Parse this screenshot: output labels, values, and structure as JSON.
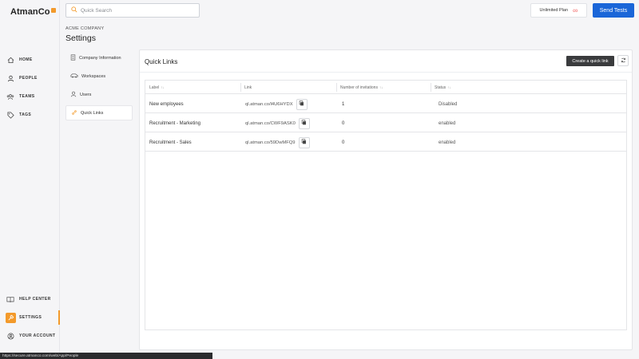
{
  "app": {
    "logo_text": "AtmanCo"
  },
  "search": {
    "placeholder": "Quick Search"
  },
  "topbar": {
    "plan_label": "Unlimited Plan",
    "plan_symbol": "∞",
    "send_tests_label": "Send Tests"
  },
  "nav": {
    "items": [
      {
        "key": "home",
        "label": "HOME"
      },
      {
        "key": "people",
        "label": "PEOPLE"
      },
      {
        "key": "teams",
        "label": "TEAMS"
      },
      {
        "key": "tags",
        "label": "TAGS"
      }
    ],
    "bottom": [
      {
        "key": "help",
        "label": "HELP CENTER"
      },
      {
        "key": "settings",
        "label": "SETTINGS"
      },
      {
        "key": "account",
        "label": "YOUR ACCOUNT"
      }
    ]
  },
  "header": {
    "company": "ACME COMPANY",
    "title": "Settings"
  },
  "submenu": {
    "items": [
      {
        "label": "Company Information"
      },
      {
        "label": "Workspaces"
      },
      {
        "label": "Users"
      },
      {
        "label": "Quick Links"
      }
    ]
  },
  "quicklinks": {
    "title": "Quick Links",
    "create_label": "Create a quick link",
    "columns": [
      "Label",
      "Link",
      "Number of invitations",
      "Status"
    ],
    "sort_symbol": "↑↓",
    "rows": [
      {
        "label": "New employees",
        "link": "ql.atman.co/l4U6HYDX",
        "invitations": "1",
        "status": "Disabled"
      },
      {
        "label": "Recruitment - Marketing",
        "link": "ql.atman.co/CWF9ASK0",
        "invitations": "0",
        "status": "enabled"
      },
      {
        "label": "Recruitment - Sales",
        "link": "ql.atman.co/59DwMFQ9",
        "invitations": "0",
        "status": "enabled"
      }
    ]
  },
  "statusbar": {
    "url": "https://secure.atmanco.com/web/App/People"
  },
  "colors": {
    "accent": "#f39a2b",
    "primary": "#1a66d8",
    "dark_button": "#3a3b3d"
  }
}
